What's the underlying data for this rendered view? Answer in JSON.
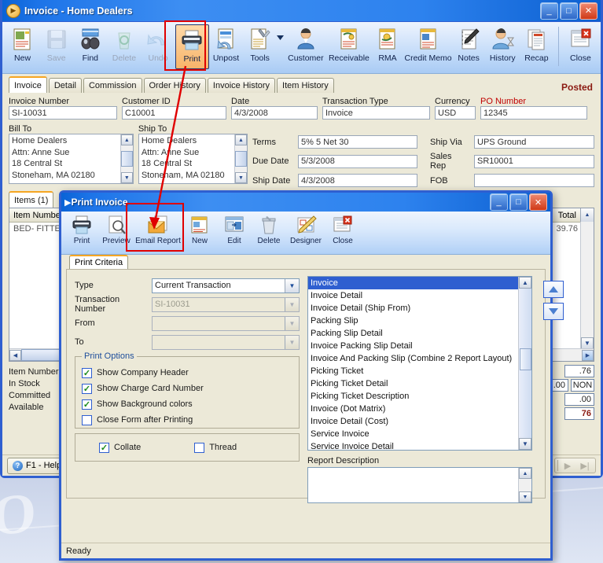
{
  "main_window": {
    "title": "Invoice - Home Dealers",
    "title_icon": "app-orb-icon",
    "window_buttons": {
      "minimize": "_",
      "maximize": "□",
      "close": "✕"
    },
    "toolbar": [
      {
        "label": "New",
        "icon": "new-document-icon",
        "state": "enabled"
      },
      {
        "label": "Save",
        "icon": "floppy-save-icon",
        "state": "disabled"
      },
      {
        "label": "Find",
        "icon": "binoculars-find-icon",
        "state": "enabled"
      },
      {
        "label": "Delete",
        "icon": "recycle-bin-delete-icon",
        "state": "disabled"
      },
      {
        "label": "Undo",
        "icon": "undo-arrow-icon",
        "state": "disabled"
      },
      {
        "label": "Print",
        "icon": "printer-icon",
        "state": "active"
      },
      {
        "label": "Unpost",
        "icon": "unpost-icon",
        "state": "enabled"
      },
      {
        "label": "Tools",
        "icon": "tools-icon",
        "state": "enabled"
      },
      {
        "label": "Customer",
        "icon": "customer-person-icon",
        "state": "enabled"
      },
      {
        "label": "Receivable",
        "icon": "receivable-icon",
        "state": "enabled"
      },
      {
        "label": "RMA",
        "icon": "rma-icon",
        "state": "enabled"
      },
      {
        "label": "Credit Memo",
        "icon": "credit-memo-icon",
        "state": "enabled"
      },
      {
        "label": "Notes",
        "icon": "notepad-pen-icon",
        "state": "enabled"
      },
      {
        "label": "History",
        "icon": "history-person-hourglass-icon",
        "state": "enabled"
      },
      {
        "label": "Recap",
        "icon": "recap-report-icon",
        "state": "enabled"
      },
      {
        "label": "Close",
        "icon": "close-window-icon",
        "state": "enabled"
      }
    ],
    "tabs": [
      {
        "label": "Invoice",
        "selected": true
      },
      {
        "label": "Detail",
        "selected": false
      },
      {
        "label": "Commission",
        "selected": false
      },
      {
        "label": "Order History",
        "selected": false
      },
      {
        "label": "Invoice History",
        "selected": false
      },
      {
        "label": "Item History",
        "selected": false
      }
    ],
    "status_label": "Posted",
    "fields": {
      "invoice_number": {
        "label": "Invoice Number",
        "value": "SI-10031"
      },
      "customer_id": {
        "label": "Customer ID",
        "value": "C10001"
      },
      "date": {
        "label": "Date",
        "value": "4/3/2008"
      },
      "transaction_type": {
        "label": "Transaction Type",
        "value": "Invoice"
      },
      "currency": {
        "label": "Currency",
        "value": "USD"
      },
      "po_number": {
        "label": "PO Number",
        "value": "12345",
        "label_color": "#c00000"
      },
      "bill_to": {
        "label": "Bill To",
        "lines": [
          "Home Dealers",
          "Attn: Anne Sue",
          "18 Central St",
          "Stoneham, MA 02180"
        ]
      },
      "ship_to": {
        "label": "Ship To",
        "lines": [
          "Home Dealers",
          "Attn: Anne Sue",
          "18 Central St",
          "Stoneham, MA 02180"
        ]
      },
      "terms": {
        "label": "Terms",
        "value": "5% 5 Net 30"
      },
      "due_date": {
        "label": "Due Date",
        "value": "5/3/2008"
      },
      "ship_date": {
        "label": "Ship Date",
        "value": "4/3/2008"
      },
      "ship_via": {
        "label": "Ship Via",
        "value": "UPS Ground"
      },
      "sales_rep": {
        "label": "Sales Rep",
        "value": "SR10001"
      },
      "fob": {
        "label": "FOB",
        "value": ""
      }
    },
    "items_panel": {
      "tab_label": "Items (1)",
      "columns": [
        "Item Number",
        "Total"
      ],
      "rows": [
        {
          "item_number": "BED- FITTED",
          "total": "39.76"
        }
      ],
      "summary_labels": [
        "Item Number",
        "In Stock",
        "Committed",
        "Available"
      ],
      "totals": [
        {
          "value": ".76",
          "tax_code": ""
        },
        {
          "value": ".00",
          "tax_code": "NON"
        },
        {
          "value": ".00",
          "tax_code": ""
        },
        {
          "value": "76",
          "tax_code": "",
          "bold": true
        }
      ]
    },
    "bottom_bar": {
      "help_label": "F1 - Help",
      "help_icon": "question-circle-icon",
      "nav_next_icon": "play-next-icon",
      "nav_last_icon": "skip-last-icon"
    }
  },
  "print_dialog": {
    "title": "Print Invoice",
    "title_icon": "app-orb-icon",
    "window_buttons": {
      "minimize": "_",
      "maximize": "□",
      "close": "✕"
    },
    "toolbar": [
      {
        "label": "Print",
        "icon": "printer-icon"
      },
      {
        "label": "Preview",
        "icon": "magnifier-preview-icon"
      },
      {
        "label": "Email Report",
        "icon": "envelope-email-icon",
        "highlighted": true
      },
      {
        "label": "New",
        "icon": "new-report-icon"
      },
      {
        "label": "Edit",
        "icon": "edit-window-icon"
      },
      {
        "label": "Delete",
        "icon": "recycle-bin-delete-icon"
      },
      {
        "label": "Designer",
        "icon": "designer-pencil-icon"
      },
      {
        "label": "Close",
        "icon": "close-window-icon"
      }
    ],
    "tab_label": "Print Criteria",
    "criteria": {
      "type": {
        "label": "Type",
        "value": "Current Transaction",
        "enabled": true
      },
      "transaction_number": {
        "label": "Transaction Number",
        "value": "SI-10031",
        "enabled": false
      },
      "from": {
        "label": "From",
        "value": "",
        "enabled": false
      },
      "to": {
        "label": "To",
        "value": "",
        "enabled": false
      }
    },
    "print_options": {
      "title": "Print Options",
      "items": [
        {
          "label": "Show Company Header",
          "checked": true
        },
        {
          "label": "Show Charge Card Number",
          "checked": true
        },
        {
          "label": "Show Background colors",
          "checked": true
        },
        {
          "label": "Close Form after Printing",
          "checked": false
        }
      ]
    },
    "bottom_options": [
      {
        "label": "Collate",
        "checked": true
      },
      {
        "label": "Thread",
        "checked": false
      }
    ],
    "report_list": {
      "selected": "Invoice",
      "items": [
        "Invoice",
        "Invoice Detail",
        "Invoice Detail (Ship From)",
        "Packing Slip",
        "Packing Slip Detail",
        "Invoice Packing Slip Detail",
        "Invoice And Packing Slip (Combine 2 Report Layout)",
        "Picking Ticket",
        "Picking Ticket Detail",
        "Picking Ticket Description",
        "Invoice (Dot Matrix)",
        "Invoice Detail (Cost)",
        "Service Invoice",
        "Service Invoice Detail"
      ]
    },
    "move_buttons": [
      {
        "icon": "move-up-icon"
      },
      {
        "icon": "move-down-icon"
      }
    ],
    "report_description": {
      "label": "Report Description",
      "value": ""
    },
    "status_text": "Ready"
  },
  "annotation": {
    "color": "#e00000",
    "highlight_1": "print-toolbar-button",
    "highlight_2": "email-report-button"
  },
  "watermark": {
    "text": "O R"
  }
}
